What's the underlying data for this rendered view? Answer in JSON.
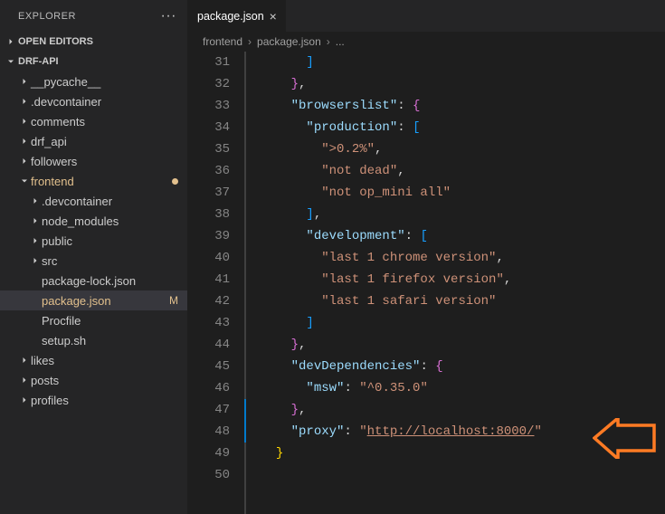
{
  "explorer": {
    "title": "EXPLORER",
    "openEditors": "OPEN EDITORS",
    "rootName": "DRF-API",
    "tree": [
      {
        "label": "__pycache__",
        "depth": 1,
        "expanded": false,
        "type": "folder"
      },
      {
        "label": ".devcontainer",
        "depth": 1,
        "expanded": false,
        "type": "folder"
      },
      {
        "label": "comments",
        "depth": 1,
        "expanded": false,
        "type": "folder"
      },
      {
        "label": "drf_api",
        "depth": 1,
        "expanded": false,
        "type": "folder"
      },
      {
        "label": "followers",
        "depth": 1,
        "expanded": false,
        "type": "folder"
      },
      {
        "label": "frontend",
        "depth": 1,
        "expanded": true,
        "type": "folder",
        "modified": true,
        "dot": true
      },
      {
        "label": ".devcontainer",
        "depth": 2,
        "expanded": false,
        "type": "folder"
      },
      {
        "label": "node_modules",
        "depth": 2,
        "expanded": false,
        "type": "folder"
      },
      {
        "label": "public",
        "depth": 2,
        "expanded": false,
        "type": "folder"
      },
      {
        "label": "src",
        "depth": 2,
        "expanded": false,
        "type": "folder"
      },
      {
        "label": "package-lock.json",
        "depth": 2,
        "type": "file"
      },
      {
        "label": "package.json",
        "depth": 2,
        "type": "file",
        "active": true,
        "status": "M"
      },
      {
        "label": "Procfile",
        "depth": 2,
        "type": "file"
      },
      {
        "label": "setup.sh",
        "depth": 2,
        "type": "file"
      },
      {
        "label": "likes",
        "depth": 1,
        "expanded": false,
        "type": "folder"
      },
      {
        "label": "posts",
        "depth": 1,
        "expanded": false,
        "type": "folder"
      },
      {
        "label": "profiles",
        "depth": 1,
        "expanded": false,
        "type": "folder"
      }
    ]
  },
  "tab": {
    "title": "package.json"
  },
  "breadcrumb": {
    "seg1": "frontend",
    "seg2": "package.json",
    "seg3": "..."
  },
  "code": {
    "startLine": 31,
    "lines": [
      {
        "indent": 3,
        "tokens": [
          {
            "t": "]",
            "c": "brace3"
          }
        ]
      },
      {
        "indent": 2,
        "tokens": [
          {
            "t": "}",
            "c": "brace2"
          },
          {
            "t": ",",
            "c": "punc"
          }
        ]
      },
      {
        "indent": 2,
        "tokens": [
          {
            "t": "\"browserslist\"",
            "c": "key"
          },
          {
            "t": ": ",
            "c": "punc"
          },
          {
            "t": "{",
            "c": "brace2"
          }
        ]
      },
      {
        "indent": 3,
        "tokens": [
          {
            "t": "\"production\"",
            "c": "key"
          },
          {
            "t": ": ",
            "c": "punc"
          },
          {
            "t": "[",
            "c": "brace3"
          }
        ]
      },
      {
        "indent": 4,
        "tokens": [
          {
            "t": "\">0.2%\"",
            "c": "str"
          },
          {
            "t": ",",
            "c": "punc"
          }
        ]
      },
      {
        "indent": 4,
        "tokens": [
          {
            "t": "\"not dead\"",
            "c": "str"
          },
          {
            "t": ",",
            "c": "punc"
          }
        ]
      },
      {
        "indent": 4,
        "tokens": [
          {
            "t": "\"not op_mini all\"",
            "c": "str"
          }
        ]
      },
      {
        "indent": 3,
        "tokens": [
          {
            "t": "]",
            "c": "brace3"
          },
          {
            "t": ",",
            "c": "punc"
          }
        ]
      },
      {
        "indent": 3,
        "tokens": [
          {
            "t": "\"development\"",
            "c": "key"
          },
          {
            "t": ": ",
            "c": "punc"
          },
          {
            "t": "[",
            "c": "brace3"
          }
        ]
      },
      {
        "indent": 4,
        "tokens": [
          {
            "t": "\"last 1 chrome version\"",
            "c": "str"
          },
          {
            "t": ",",
            "c": "punc"
          }
        ]
      },
      {
        "indent": 4,
        "tokens": [
          {
            "t": "\"last 1 firefox version\"",
            "c": "str"
          },
          {
            "t": ",",
            "c": "punc"
          }
        ]
      },
      {
        "indent": 4,
        "tokens": [
          {
            "t": "\"last 1 safari version\"",
            "c": "str"
          }
        ]
      },
      {
        "indent": 3,
        "tokens": [
          {
            "t": "]",
            "c": "brace3"
          }
        ]
      },
      {
        "indent": 2,
        "tokens": [
          {
            "t": "}",
            "c": "brace2"
          },
          {
            "t": ",",
            "c": "punc"
          }
        ]
      },
      {
        "indent": 2,
        "tokens": [
          {
            "t": "\"devDependencies\"",
            "c": "key"
          },
          {
            "t": ": ",
            "c": "punc"
          },
          {
            "t": "{",
            "c": "brace2"
          }
        ]
      },
      {
        "indent": 3,
        "tokens": [
          {
            "t": "\"msw\"",
            "c": "key"
          },
          {
            "t": ": ",
            "c": "punc"
          },
          {
            "t": "\"^0.35.0\"",
            "c": "str"
          }
        ]
      },
      {
        "indent": 2,
        "tokens": [
          {
            "t": "}",
            "c": "brace2"
          },
          {
            "t": ",",
            "c": "punc"
          }
        ],
        "hl": true
      },
      {
        "indent": 2,
        "tokens": [
          {
            "t": "\"proxy\"",
            "c": "key"
          },
          {
            "t": ": ",
            "c": "punc"
          },
          {
            "t": "\"",
            "c": "str"
          },
          {
            "t": "http://localhost:8000/",
            "c": "link"
          },
          {
            "t": "\"",
            "c": "str"
          }
        ],
        "hl": true
      },
      {
        "indent": 1,
        "tokens": [
          {
            "t": "}",
            "c": "brace"
          }
        ]
      },
      {
        "indent": 0,
        "tokens": []
      }
    ]
  }
}
